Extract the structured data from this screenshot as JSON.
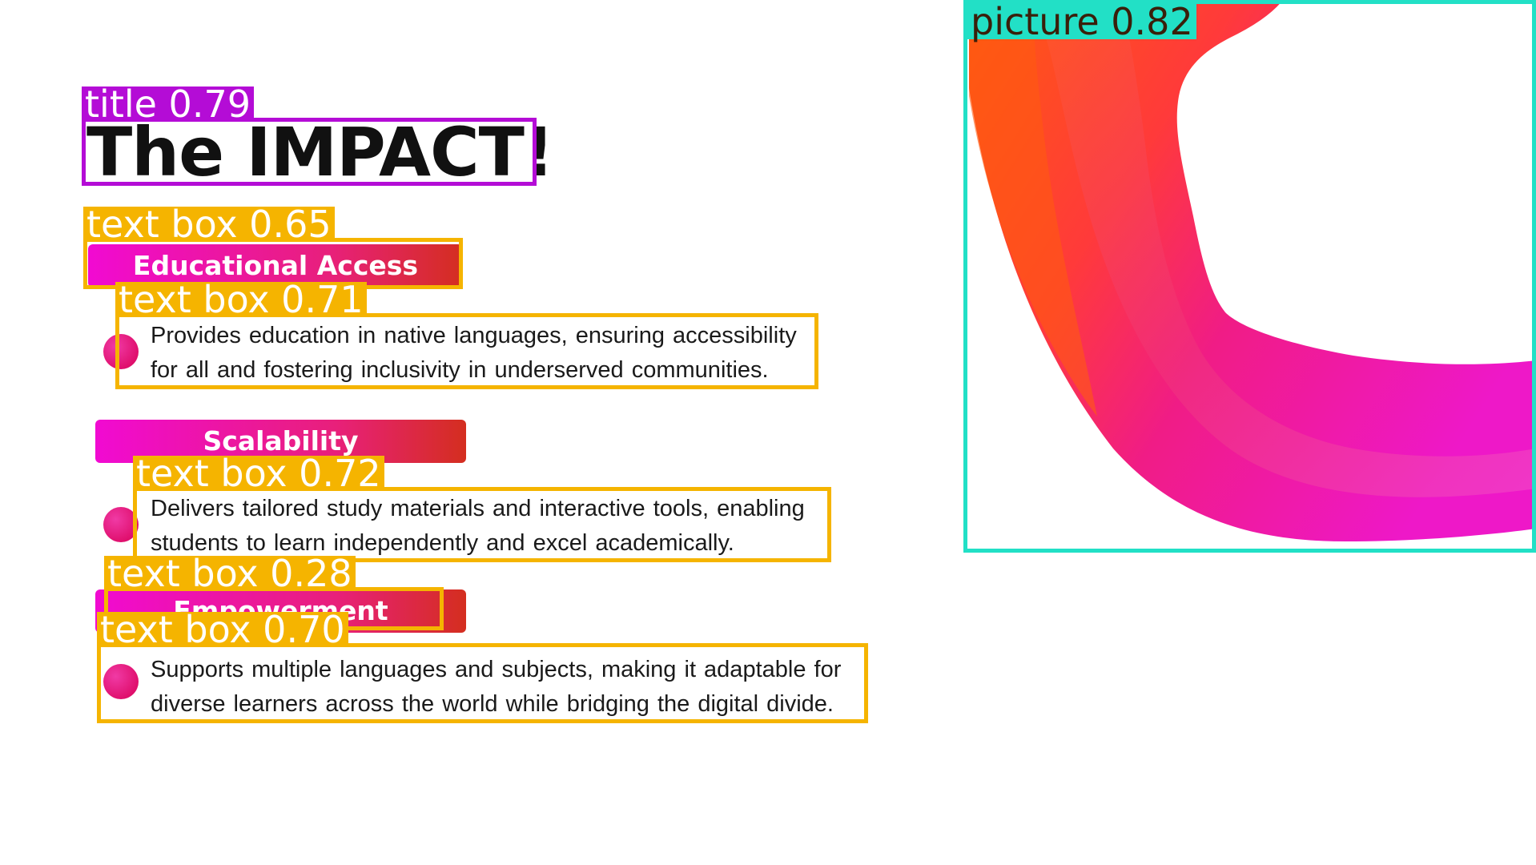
{
  "slide": {
    "title": "The IMPACT!",
    "sections": [
      {
        "heading": "Educational Access",
        "lines": [
          "Provides education in native languages, ensuring accessibility",
          "for all and fostering inclusivity in underserved communities."
        ]
      },
      {
        "heading": "Scalability",
        "lines": [
          "Delivers tailored study materials and interactive tools, enabling",
          "students to learn independently and excel academically."
        ]
      },
      {
        "heading": "Empowerment",
        "lines": [
          "Supports multiple languages and subjects, making it adaptable for",
          "diverse learners across the world while bridging the digital divide."
        ]
      }
    ]
  },
  "detections": {
    "title": "title 0.79",
    "edu_heading": "text box 0.65",
    "edu_text": "text box 0.71",
    "scal_text": "text box 0.72",
    "emp_heading": "text box 0.28",
    "emp_text": "text box 0.70",
    "picture": "picture 0.82"
  },
  "colors": {
    "title_box": "#b40cd6",
    "text_box": "#f5b400",
    "picture_box": "#22e0c6",
    "pill_start": "#f10ad2",
    "pill_end": "#d42e1f"
  }
}
